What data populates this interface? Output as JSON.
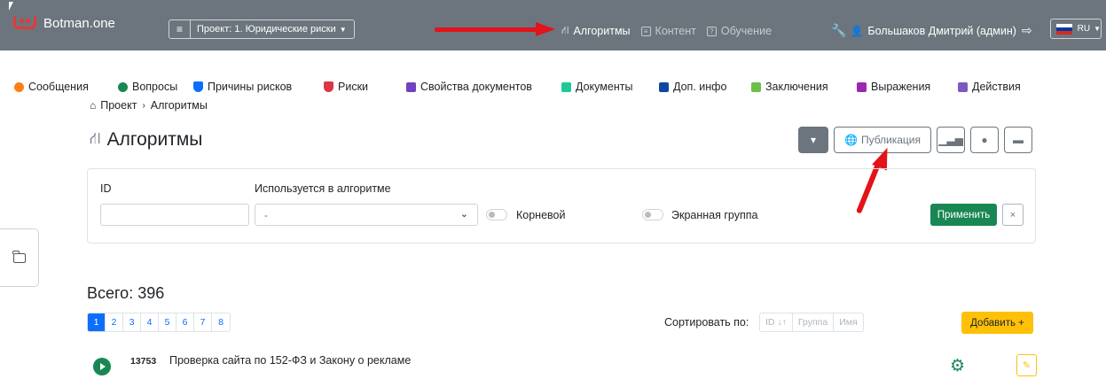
{
  "navbar": {
    "brand": "Botman.one",
    "project_label": "Проект: 1. Юридические риски",
    "links": [
      {
        "label": "Алгоритмы",
        "active": true
      },
      {
        "label": "Контент",
        "active": false
      },
      {
        "label": "Обучение",
        "active": false
      }
    ],
    "user": "Большаков Дмитрий (админ)",
    "lang": "RU"
  },
  "subnav": [
    {
      "label": "Сообщения",
      "color": "#fd7e14"
    },
    {
      "label": "Вопросы",
      "color": "#198754"
    },
    {
      "label": "Причины рисков",
      "color": "#0d6efd"
    },
    {
      "label": "Риски",
      "color": "#dc3545"
    },
    {
      "label": "Свойства документов",
      "color": "#6f42c1"
    },
    {
      "label": "Документы",
      "color": "#20c997"
    },
    {
      "label": "Доп. инфо",
      "color": "#0d47a1"
    },
    {
      "label": "Заключения",
      "color": "#6cc04a"
    },
    {
      "label": "Выражения",
      "color": "#9c27b0"
    },
    {
      "label": "Действия",
      "color": "#7e57c2"
    }
  ],
  "breadcrumb": {
    "root": "Проект",
    "current": "Алгоритмы"
  },
  "page_title": "Алгоритмы",
  "toolbar": {
    "publish_label": "Публикация"
  },
  "filter": {
    "id_label": "ID",
    "used_in_label": "Используется в алгоритме",
    "used_in_value": "-",
    "root_label": "Корневой",
    "screen_group_label": "Экранная группа",
    "apply_label": "Применить",
    "clear_label": "×"
  },
  "total": "Всего: 396",
  "pagination": [
    "1",
    "2",
    "3",
    "4",
    "5",
    "6",
    "7",
    "8"
  ],
  "sort": {
    "label": "Сортировать по:",
    "options": [
      "ID ↓↑",
      "Группа",
      "Имя"
    ]
  },
  "add_label": "Добавить +",
  "rows": [
    {
      "id": "13753",
      "title": "Проверка сайта по 152-ФЗ и Закону о рекламе"
    }
  ]
}
